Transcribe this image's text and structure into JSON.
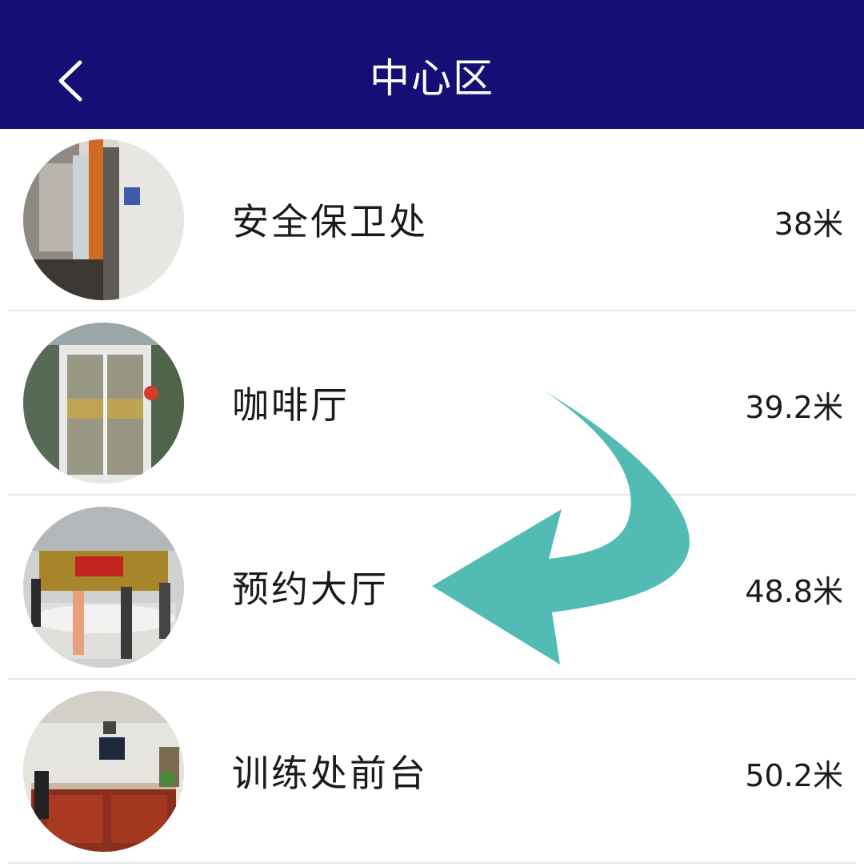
{
  "header": {
    "title": "中心区",
    "background": "#150f75"
  },
  "list": {
    "items": [
      {
        "name": "安全保卫处",
        "distance": "38米"
      },
      {
        "name": "咖啡厅",
        "distance": "39.2米"
      },
      {
        "name": "预约大厅",
        "distance": "48.8米"
      },
      {
        "name": "训练处前台",
        "distance": "50.2米"
      }
    ]
  },
  "annotation": {
    "arrow_color": "#52bcb4"
  }
}
